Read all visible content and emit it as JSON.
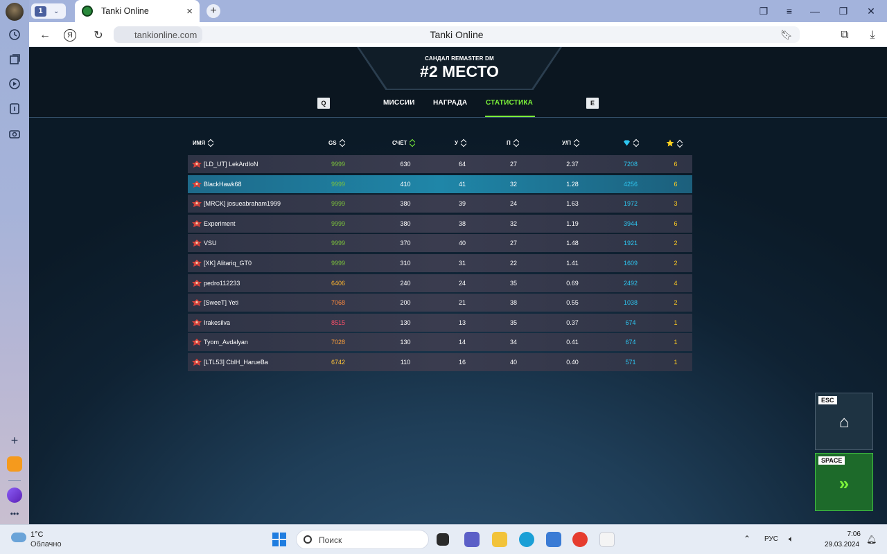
{
  "browser": {
    "tab_count": "1",
    "tab_title": "Tanki Online",
    "url": "tankionline.com",
    "page_title": "Tanki Online"
  },
  "game": {
    "map_name": "САНДАЛ REMASTER DM",
    "place": "#2 МЕСТО",
    "key_prev": "Q",
    "key_next": "E",
    "tabs": {
      "missions": "МИССИИ",
      "reward": "НАГРАДА",
      "stats": "СТАТИСТИКА"
    },
    "columns": {
      "name": "ИМЯ",
      "gs": "GS",
      "score": "СЧЁТ",
      "kills": "У",
      "deaths": "П",
      "kd": "У/П"
    },
    "players": [
      {
        "name": "[LD_UT] LekArdIoN",
        "gs": "9999",
        "score": "630",
        "kills": "64",
        "deaths": "27",
        "kd": "2.37",
        "crystals": "7208",
        "stars": "6"
      },
      {
        "name": "BlackHawk68",
        "gs": "9999",
        "score": "410",
        "kills": "41",
        "deaths": "32",
        "kd": "1.28",
        "crystals": "4256",
        "stars": "6"
      },
      {
        "name": "[MRCK] josueabraham1999",
        "gs": "9999",
        "score": "380",
        "kills": "39",
        "deaths": "24",
        "kd": "1.63",
        "crystals": "1972",
        "stars": "3"
      },
      {
        "name": "Experiment",
        "gs": "9999",
        "score": "380",
        "kills": "38",
        "deaths": "32",
        "kd": "1.19",
        "crystals": "3944",
        "stars": "6"
      },
      {
        "name": "VSU",
        "gs": "9999",
        "score": "370",
        "kills": "40",
        "deaths": "27",
        "kd": "1.48",
        "crystals": "1921",
        "stars": "2"
      },
      {
        "name": "[XK] Alitariq_GT0",
        "gs": "9999",
        "score": "310",
        "kills": "31",
        "deaths": "22",
        "kd": "1.41",
        "crystals": "1609",
        "stars": "2"
      },
      {
        "name": "pedro112233",
        "gs": "6406",
        "score": "240",
        "kills": "24",
        "deaths": "35",
        "kd": "0.69",
        "crystals": "2492",
        "stars": "4"
      },
      {
        "name": "[SweeT] Yeti",
        "gs": "7068",
        "score": "200",
        "kills": "21",
        "deaths": "38",
        "kd": "0.55",
        "crystals": "1038",
        "stars": "2"
      },
      {
        "name": "Irakesilva",
        "gs": "8515",
        "score": "130",
        "kills": "13",
        "deaths": "35",
        "kd": "0.37",
        "crystals": "674",
        "stars": "1"
      },
      {
        "name": "Tyom_Avdalyan",
        "gs": "7028",
        "score": "130",
        "kills": "14",
        "deaths": "34",
        "kd": "0.41",
        "crystals": "674",
        "stars": "1"
      },
      {
        "name": "[LTL53] CblH_HarueBa",
        "gs": "6742",
        "score": "110",
        "kills": "16",
        "deaths": "40",
        "kd": "0.40",
        "crystals": "571",
        "stars": "1"
      }
    ],
    "gs_colors": [
      "#7cc23b",
      "#7cc23b",
      "#7cc23b",
      "#7cc23b",
      "#7cc23b",
      "#7cc23b",
      "#ffb52e",
      "#ff8a3d",
      "#ff4f6a",
      "#ffa13a",
      "#ffc53a"
    ],
    "highlight_row": 1,
    "esc_key": "ESC",
    "space_key": "SPACE",
    "accent": "#7cf33a"
  },
  "taskbar": {
    "temperature": "1°C",
    "weather": "Облачно",
    "search_placeholder": "Поиск",
    "lang": "РУС",
    "time": "7:06",
    "date": "29.03.2024"
  }
}
